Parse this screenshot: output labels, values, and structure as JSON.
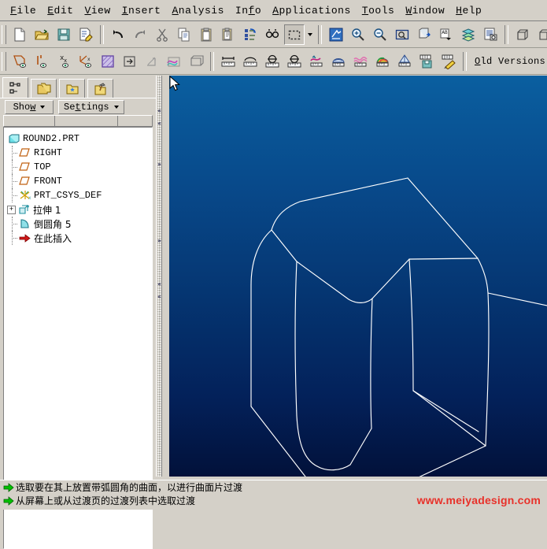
{
  "menu": {
    "items": [
      {
        "pre": "",
        "key": "F",
        "post": "ile",
        "name": "menu-file"
      },
      {
        "pre": "",
        "key": "E",
        "post": "dit",
        "name": "menu-edit"
      },
      {
        "pre": "",
        "key": "V",
        "post": "iew",
        "name": "menu-view"
      },
      {
        "pre": "",
        "key": "I",
        "post": "nsert",
        "name": "menu-insert"
      },
      {
        "pre": "",
        "key": "A",
        "post": "nalysis",
        "name": "menu-analysis"
      },
      {
        "pre": "In",
        "key": "f",
        "post": "o",
        "name": "menu-info"
      },
      {
        "pre": "",
        "key": "A",
        "post": "pplications",
        "name": "menu-applications"
      },
      {
        "pre": "",
        "key": "T",
        "post": "ools",
        "name": "menu-tools"
      },
      {
        "pre": "",
        "key": "W",
        "post": "indow",
        "name": "menu-window"
      },
      {
        "pre": "",
        "key": "H",
        "post": "elp",
        "name": "menu-help"
      }
    ]
  },
  "toolbar_row1": {
    "icons": [
      "new-file-icon",
      "open-folder-icon",
      "save-icon",
      "print-preview-icon",
      "undo-icon",
      "redo-icon",
      "cut-icon",
      "copy-icon",
      "paste-icon",
      "paste-special-icon",
      "regenerate-icon",
      "find-icon",
      "selection-box-icon",
      "repaint-icon",
      "zoom-in-icon",
      "zoom-out-icon",
      "refit-icon",
      "reorient-icon",
      "saved-view-icon",
      "layers-icon",
      "view-manager-icon",
      "wireframe-icon",
      "hidden-line-icon"
    ]
  },
  "toolbar_row2": {
    "icons": [
      "datum-plane-display-icon",
      "datum-axis-display-icon",
      "datum-point-display-icon",
      "datum-csys-display-icon",
      "shaded-surface-icon",
      "extrude-icon",
      "revolve-icon",
      "sweep-icon",
      "blend-icon",
      "measure-distance-icon",
      "measure-area-icon",
      "measure-angle-icon",
      "measure-diameter-icon",
      "curve-analysis-icon",
      "surface-analysis-icon",
      "curvature-analysis-icon",
      "color-analysis-icon",
      "draft-analysis-icon",
      "save-analysis-icon",
      "delete-analysis-icon"
    ],
    "old_versions": {
      "pre": "",
      "key": "O",
      "mid": "ld Versions Set",
      "key2": "u",
      "post": "p.."
    }
  },
  "left_panel": {
    "tabs": [
      {
        "name": "tab-model-tree",
        "icon": "tree-icon"
      },
      {
        "name": "tab-folder-browser",
        "icon": "folders-icon"
      },
      {
        "name": "tab-favorites",
        "icon": "favorites-folder-icon"
      },
      {
        "name": "tab-connections",
        "icon": "toolbox-folder-icon"
      }
    ],
    "show_button": {
      "pre": "Sho",
      "key": "w",
      "post": ""
    },
    "settings_button": {
      "pre": "Se",
      "key": "t",
      "post": "tings"
    },
    "tree": [
      {
        "label": "ROUND2.PRT",
        "icon": "part-icon",
        "depth": 0,
        "expander": "",
        "cjk": false,
        "name": "tree-item-part"
      },
      {
        "label": "RIGHT",
        "icon": "datum-plane-icon",
        "depth": 1,
        "expander": "",
        "cjk": false,
        "name": "tree-item-right"
      },
      {
        "label": "TOP",
        "icon": "datum-plane-icon",
        "depth": 1,
        "expander": "",
        "cjk": false,
        "name": "tree-item-top"
      },
      {
        "label": "FRONT",
        "icon": "datum-plane-icon",
        "depth": 1,
        "expander": "",
        "cjk": false,
        "name": "tree-item-front"
      },
      {
        "label": "PRT_CSYS_DEF",
        "icon": "coordinate-system-icon",
        "depth": 1,
        "expander": "",
        "cjk": false,
        "name": "tree-item-csys"
      },
      {
        "label": "拉伸 1",
        "icon": "extrude-feature-icon",
        "depth": 1,
        "expander": "+",
        "cjk": true,
        "name": "tree-item-extrude-1"
      },
      {
        "label": "倒圆角 5",
        "icon": "round-feature-icon",
        "depth": 1,
        "expander": "",
        "cjk": true,
        "name": "tree-item-round-5"
      },
      {
        "label": "在此插入",
        "icon": "insert-here-arrow-icon",
        "depth": 1,
        "expander": "",
        "cjk": true,
        "name": "tree-item-insert-here"
      }
    ]
  },
  "viewport": {
    "name": "graphics-window",
    "background_top": "#0a5fa0",
    "background_bottom": "#02113a",
    "geometry_color": "#ffffff",
    "model": "rounded-box-wireframe",
    "cursor": "arrow-pointer"
  },
  "status_bar": {
    "line1": "选取要在其上放置带弧圆角的曲面，以进行曲面片过渡",
    "line2": "从屏幕上或从过渡页的过渡列表中选取过渡",
    "arrow_color": "#00c000"
  },
  "watermark": {
    "text": "www.meiyadesign.com",
    "color": "#e8312a"
  }
}
